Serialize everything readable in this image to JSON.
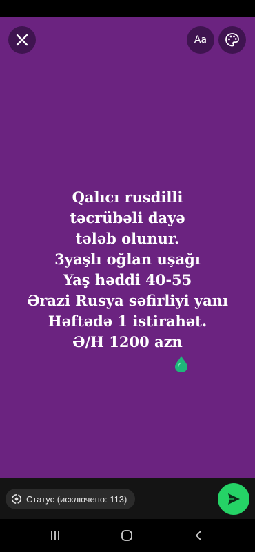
{
  "story": {
    "background": "#6b2380",
    "text_lines": [
      "Qalıcı rusdilli",
      "təcrübəli  dayə",
      "tələb olunur.",
      "3yaşlı oğlan uşağı",
      "Yaş həddi 40-55",
      "Ərazi Rusya səfirliyi yanı",
      "Həftədə 1 istirahət.",
      "Ə/H 1200 azn"
    ],
    "emoji": "green-drop"
  },
  "top_bar": {
    "close_icon": "close-icon",
    "text_style_label": "Aa",
    "palette_icon": "palette-icon"
  },
  "bottom_bar": {
    "status_label": "Статус (исключено: 113)",
    "send_icon": "send-icon",
    "accent": "#25d366"
  },
  "nav": {
    "recents_icon": "recents-icon",
    "home_icon": "home-icon",
    "back_icon": "back-icon"
  }
}
